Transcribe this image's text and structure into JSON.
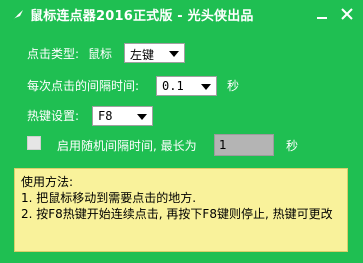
{
  "window": {
    "title": "鼠标连点器2016正式版 - 光头侠出品",
    "icon": "feather-icon",
    "minimize_icon": "minimize-icon",
    "close_icon": "close-icon"
  },
  "click_type": {
    "label": "点击类型:",
    "sub_label": "鼠标",
    "value": "左键"
  },
  "interval": {
    "label": "每次点击的间隔时间:",
    "value": "0.1",
    "unit": "秒"
  },
  "hotkey": {
    "label": "热键设置:",
    "value": "F8"
  },
  "random": {
    "checked": false,
    "label": "启用随机间隔时间, 最长为",
    "value": "1",
    "unit": "秒"
  },
  "help": {
    "title": "使用方法:",
    "step1": "1. 把鼠标移动到需要点击的地方.",
    "step2": "2. 按F8热键开始连续点击, 再按下F8键则停止, 热键可更改"
  },
  "colors": {
    "background": "#1fbf52",
    "help_background": "#f9f29b"
  }
}
